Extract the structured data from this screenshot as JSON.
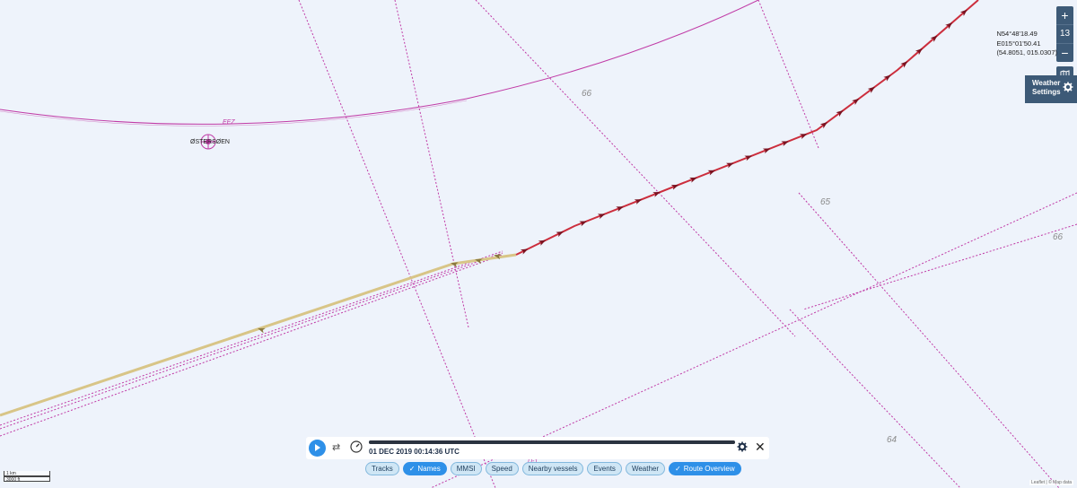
{
  "map": {
    "depth_labels": [
      "66",
      "65",
      "66",
      "64"
    ],
    "eez_label": "EEZ",
    "station_label": "ØSTERSØEN",
    "cable_label": "D-1",
    "colors": {
      "track": "#cc2e3d",
      "history_track": "#d8c587",
      "boundary": "#c03aa6",
      "lane": "#c03aa6"
    }
  },
  "controls": {
    "zoom_in": "+",
    "zoom_level": "13",
    "zoom_out": "−",
    "layers_icon": "map-layers-icon",
    "weather_settings_line1": "Weather",
    "weather_settings_line2": "Settings"
  },
  "coords": {
    "lat": "N54°48'18.49",
    "lon": "E015°01'50.41",
    "decimal": "(54.8051, 015.0307)"
  },
  "player": {
    "timestamp": "01 DEC 2019 00:14:36 UTC",
    "progress": 1.0,
    "close_label": "✕"
  },
  "chips": [
    {
      "label": "Tracks",
      "active": false
    },
    {
      "label": "Names",
      "active": true
    },
    {
      "label": "MMSI",
      "active": false
    },
    {
      "label": "Speed",
      "active": false
    },
    {
      "label": "Nearby vessels",
      "active": false
    },
    {
      "label": "Events",
      "active": false
    },
    {
      "label": "Weather",
      "active": false
    },
    {
      "label": "Route Overview",
      "active": true
    }
  ],
  "scale": {
    "metric": "1 km",
    "imperial": "3000 ft"
  },
  "attribution": "Leaflet | © Map data"
}
